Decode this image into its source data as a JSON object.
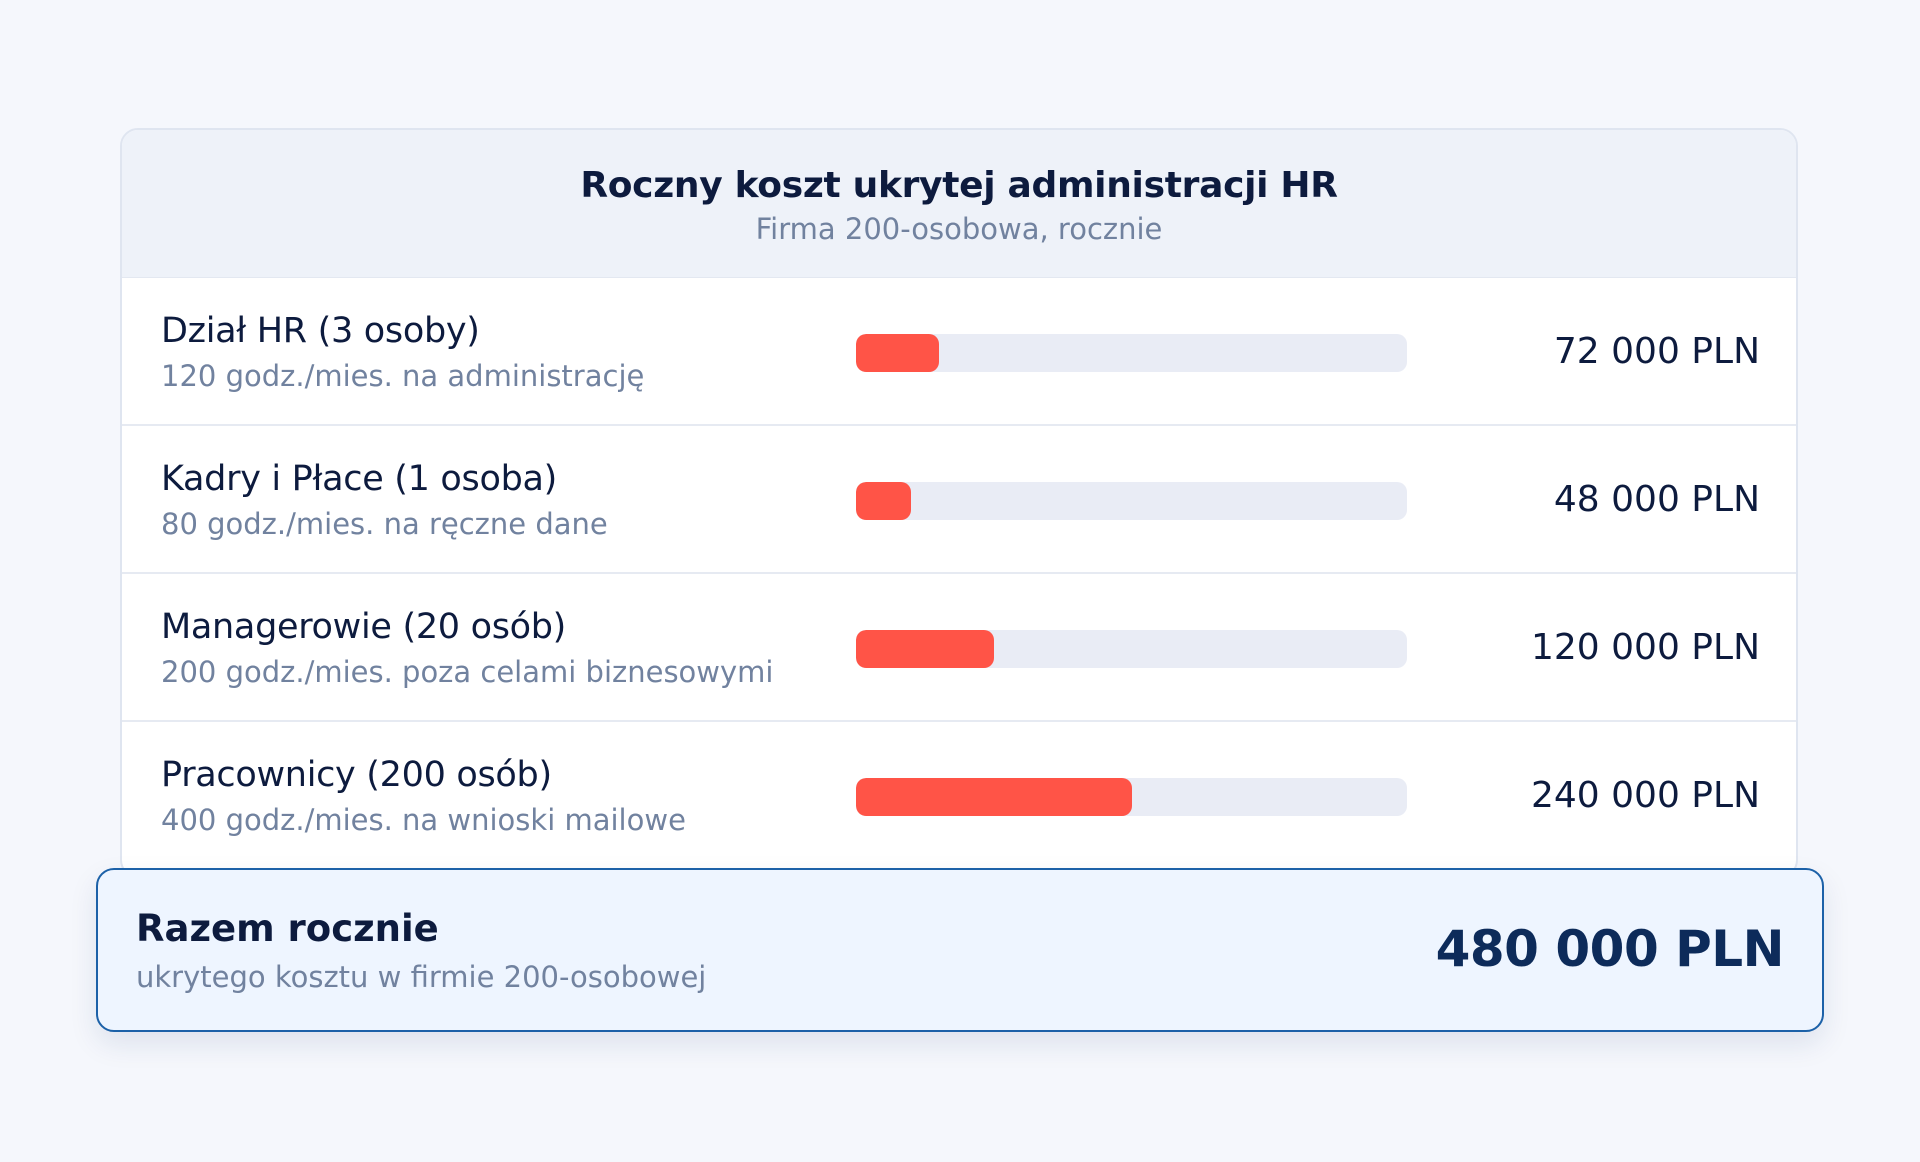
{
  "chart_data": {
    "type": "bar",
    "title": "Roczny koszt ukrytej administracji HR",
    "subtitle": "Firma 200-osobowa, rocznie",
    "categories": [
      "Dział HR (3 osoby)",
      "Kadry i Płace (1 osoba)",
      "Managerowie (20 osób)",
      "Pracownicy (200 osób)"
    ],
    "descriptions": [
      "120 godz./mies. na administrację",
      "80 godz./mies. na ręczne dane",
      "200 godz./mies. poza celami biznesowymi",
      "400 godz./mies. na wnioski mailowe"
    ],
    "values": [
      72000,
      48000,
      120000,
      240000
    ],
    "value_labels": [
      "72 000 PLN",
      "48 000 PLN",
      "120 000 PLN",
      "240 000 PLN"
    ],
    "bar_max": 480000,
    "bar_color": "#ff5447",
    "track_color": "#e9ecf5",
    "total": {
      "title": "Razem rocznie",
      "subtitle": "ukrytego kosztu w firmie 200-osobowej",
      "value": 480000,
      "value_label": "480 000 PLN"
    }
  }
}
